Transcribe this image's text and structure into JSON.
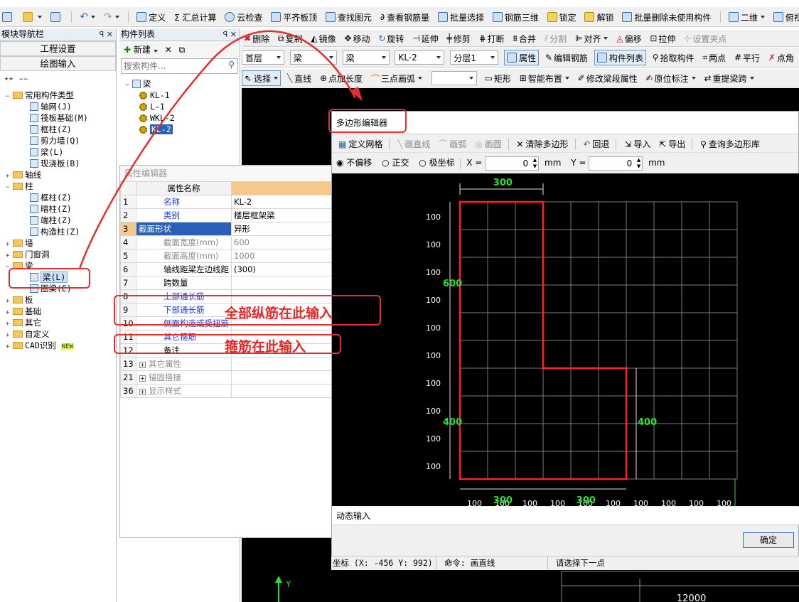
{
  "toolbar1": {
    "define": "定义",
    "sum": "Σ 汇总计算",
    "cloud_check": "云检查",
    "level_board": "平齐板顶",
    "find": "查找图元",
    "view_rebar": "查看钢筋量",
    "batch_select": "批量选择",
    "rebar3d": "钢筋三维",
    "lock": "锁定",
    "unlock": "解锁",
    "batch_delete": "批量删除未使用构件",
    "view2d": "二维",
    "view_top": "俯视"
  },
  "toolbar2": {
    "delete": "删除",
    "copy": "复制",
    "mirror": "镜像",
    "move": "移动",
    "rotate": "旋转",
    "extend": "延伸",
    "trim": "修剪",
    "break": "打断",
    "merge": "合并",
    "split": "分割",
    "align": "对齐",
    "offset": "偏移",
    "stretch": "拉伸",
    "set_point": "设置夹点"
  },
  "toolbar3": {
    "floor": "首层",
    "cat1": "梁",
    "cat2": "梁",
    "element": "KL-2",
    "layer": "分层1",
    "property": "属性",
    "edit_rebar": "编辑钢筋",
    "comp_list": "构件列表",
    "pick": "拾取构件",
    "two_point": "两点",
    "parallel": "平行",
    "point": "点角"
  },
  "toolbar4": {
    "select": "选择",
    "line": "直线",
    "point_len": "点加长度",
    "arc3": "三点画弧",
    "rect": "矩形",
    "smart": "智能布置",
    "modify_span": "修改梁段属性",
    "orig_mark": "原位标注",
    "reextract": "重提梁跨"
  },
  "nav": {
    "title": "模块导航栏",
    "project": "工程设置",
    "draw": "绘图输入",
    "tree": [
      {
        "label": "常用构件类型",
        "level": 0,
        "type": "folder",
        "exp": "−"
      },
      {
        "label": "轴网(J)",
        "level": 1,
        "type": "comp"
      },
      {
        "label": "筏板基础(M)",
        "level": 1,
        "type": "comp"
      },
      {
        "label": "框柱(Z)",
        "level": 1,
        "type": "comp"
      },
      {
        "label": "剪力墙(Q)",
        "level": 1,
        "type": "comp"
      },
      {
        "label": "梁(L)",
        "level": 1,
        "type": "comp"
      },
      {
        "label": "现浇板(B)",
        "level": 1,
        "type": "comp"
      },
      {
        "label": "轴线",
        "level": 0,
        "type": "folder",
        "exp": "+"
      },
      {
        "label": "柱",
        "level": 0,
        "type": "folder",
        "exp": "−"
      },
      {
        "label": "框柱(Z)",
        "level": 1,
        "type": "comp"
      },
      {
        "label": "暗柱(Z)",
        "level": 1,
        "type": "comp"
      },
      {
        "label": "端柱(Z)",
        "level": 1,
        "type": "comp"
      },
      {
        "label": "构造柱(Z)",
        "level": 1,
        "type": "comp"
      },
      {
        "label": "墙",
        "level": 0,
        "type": "folder",
        "exp": "+"
      },
      {
        "label": "门窗洞",
        "level": 0,
        "type": "folder",
        "exp": "+"
      },
      {
        "label": "梁",
        "level": 0,
        "type": "folder",
        "exp": "−"
      },
      {
        "label": "梁(L)",
        "level": 1,
        "type": "comp",
        "selected": true
      },
      {
        "label": "圈梁(E)",
        "level": 1,
        "type": "comp"
      },
      {
        "label": "板",
        "level": 0,
        "type": "folder",
        "exp": "+"
      },
      {
        "label": "基础",
        "level": 0,
        "type": "folder",
        "exp": "+"
      },
      {
        "label": "其它",
        "level": 0,
        "type": "folder",
        "exp": "+"
      },
      {
        "label": "自定义",
        "level": 0,
        "type": "folder",
        "exp": "+"
      },
      {
        "label": "CAD识别",
        "level": 0,
        "type": "folder",
        "exp": "+",
        "badge": "NEW"
      }
    ]
  },
  "complist": {
    "title": "构件列表",
    "new": "新建",
    "search_placeholder": "搜索构件...",
    "root": "梁",
    "items": [
      "KL-1",
      "L-1",
      "WKL-2",
      "KL-2"
    ]
  },
  "props": {
    "title": "属性编辑器",
    "header_name": "属性名称",
    "rows": [
      {
        "no": "1",
        "name": "名称",
        "value": "KL-2",
        "style": "blue"
      },
      {
        "no": "2",
        "name": "类别",
        "value": "楼层框架梁",
        "style": "blue"
      },
      {
        "no": "3",
        "name": "截面形状",
        "value": "异形",
        "style": "sel"
      },
      {
        "no": "4",
        "name": "截面宽度(mm)",
        "value": "600",
        "style": "gray"
      },
      {
        "no": "5",
        "name": "截面高度(mm)",
        "value": "1000",
        "style": "gray"
      },
      {
        "no": "6",
        "name": "轴线距梁左边线距",
        "value": "(300)",
        "style": ""
      },
      {
        "no": "7",
        "name": "跨数量",
        "value": "",
        "style": ""
      },
      {
        "no": "8",
        "name": "上部通长筋",
        "value": "",
        "style": "blue"
      },
      {
        "no": "9",
        "name": "下部通长筋",
        "value": "",
        "style": "blue"
      },
      {
        "no": "10",
        "name": "侧面构造或受扭筋",
        "value": "",
        "style": "blue"
      },
      {
        "no": "11",
        "name": "其它箍筋",
        "value": "",
        "style": "blue"
      },
      {
        "no": "12",
        "name": "备注",
        "value": "",
        "style": ""
      },
      {
        "no": "13",
        "name": "其它属性",
        "value": "",
        "style": "group"
      },
      {
        "no": "21",
        "name": "锚固搭接",
        "value": "",
        "style": "group"
      },
      {
        "no": "36",
        "name": "显示样式",
        "value": "",
        "style": "group"
      }
    ]
  },
  "annotations": {
    "longitudinal": "全部纵筋在此输入",
    "stirrup": "箍筋在此输入"
  },
  "editor": {
    "title": "多边形编辑器",
    "define_grid": "定义网格",
    "draw_line": "画直线",
    "draw_arc": "画弧",
    "draw_circle": "画圆",
    "clear": "清除多边形",
    "undo": "回退",
    "import": "导入",
    "export": "导出",
    "query_lib": "查询多边形库",
    "opt_none": "不偏移",
    "opt_ortho": "正交",
    "opt_polar": "极坐标",
    "x_label": "X =",
    "x_value": "0",
    "y_label": "Y =",
    "y_value": "0",
    "unit": "mm",
    "dim_top": "300",
    "dim_bottom_left": "300",
    "dim_bottom_right": "300",
    "dim_left_top": "600",
    "dim_left_bottom": "400",
    "dim_right": "400",
    "row_label": "100",
    "col_label": "100",
    "dynamic_input": "动态输入",
    "ok": "确定"
  },
  "status": {
    "coord": "坐标 (X: -456 Y: 992)",
    "command": "命令: 画直线",
    "prompt": "请选择下一点"
  },
  "bottom_dim": "12000",
  "axis_y": "Y"
}
